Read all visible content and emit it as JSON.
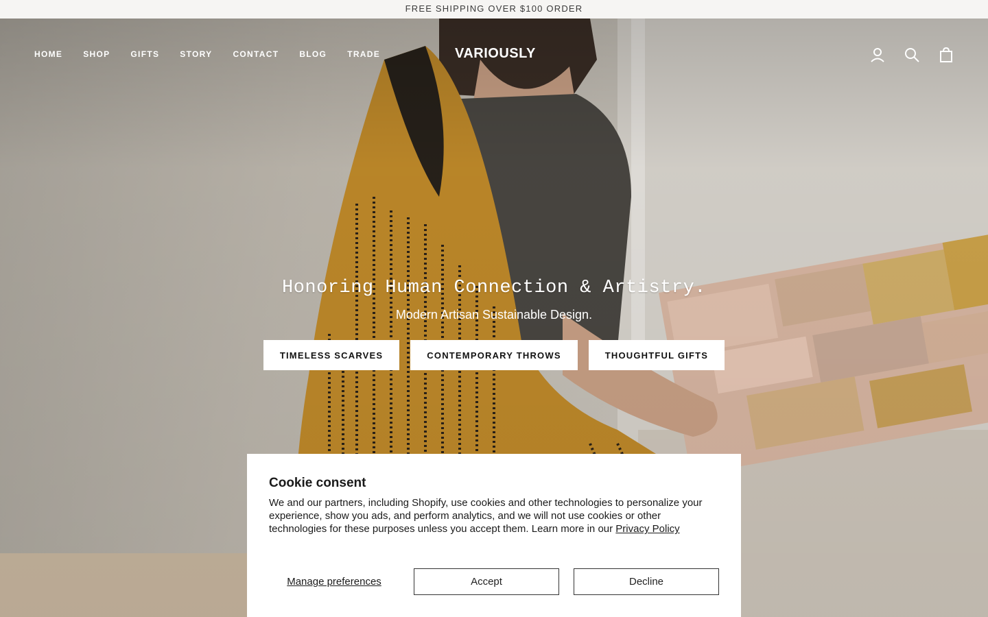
{
  "announcement": {
    "text": "FREE SHIPPING OVER $100 ORDER"
  },
  "header": {
    "nav": [
      "HOME",
      "SHOP",
      "GIFTS",
      "STORY",
      "CONTACT",
      "BLOG",
      "TRADE"
    ],
    "logo_text": "VARIOUSLY",
    "icons": [
      "account-icon",
      "search-icon",
      "cart-icon"
    ]
  },
  "hero": {
    "title": "Honoring Human Connection & Artistry.",
    "subtitle": "Modern Artisan Sustainable Design.",
    "buttons": [
      "TIMELESS SCARVES",
      "CONTEMPORARY THROWS",
      "THOUGHTFUL GIFTS"
    ]
  },
  "cookie": {
    "title": "Cookie consent",
    "body": "We and our partners, including Shopify, use cookies and other technologies to personalize your experience, show you ads, and perform analytics, and we will not use cookies or other technologies for these purposes unless you accept them. Learn more in our ",
    "policy_link": "Privacy Policy",
    "manage": "Manage preferences",
    "accept": "Accept",
    "decline": "Decline"
  },
  "colors": {
    "throw_mustard": "#c08a2a",
    "announce_bg": "#f6f5f3"
  }
}
